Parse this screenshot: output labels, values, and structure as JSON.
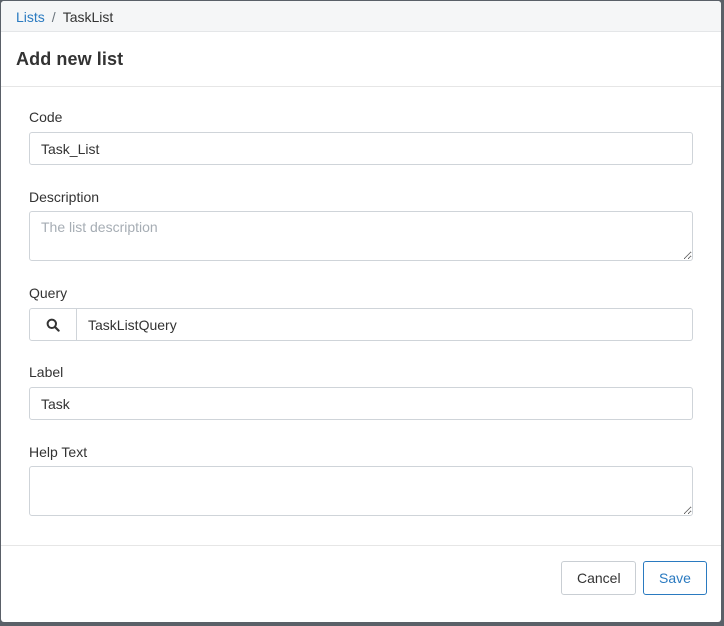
{
  "breadcrumb": {
    "parent": "Lists",
    "separator": "/",
    "current": "TaskList"
  },
  "dialog": {
    "title": "Add new list"
  },
  "form": {
    "code": {
      "label": "Code",
      "value": "Task_List"
    },
    "description": {
      "label": "Description",
      "value": "",
      "placeholder": "The list description"
    },
    "query": {
      "label": "Query",
      "value": "TaskListQuery",
      "icon": "search-icon"
    },
    "label": {
      "label": "Label",
      "value": "Task"
    },
    "help_text": {
      "label": "Help Text",
      "value": ""
    }
  },
  "footer": {
    "cancel_label": "Cancel",
    "save_label": "Save"
  },
  "colors": {
    "link": "#2a7ac0",
    "primary_outline": "#2a7ac0",
    "border": "#cfd4d9",
    "backdrop": "#555c63"
  }
}
